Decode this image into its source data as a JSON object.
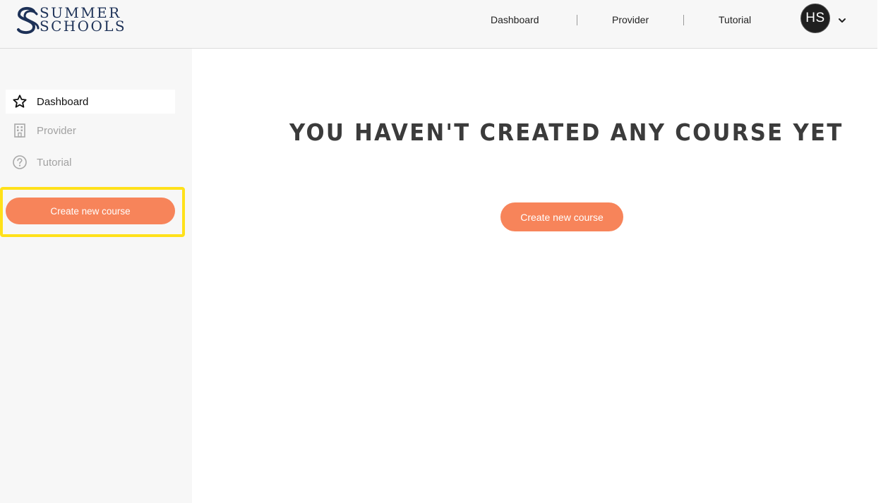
{
  "brand": {
    "line1": "SUMMER",
    "line2": "SCHOOLS",
    "color": "#1d3157"
  },
  "topnav": {
    "items": [
      {
        "label": "Dashboard"
      },
      {
        "label": "Provider"
      },
      {
        "label": "Tutorial"
      }
    ],
    "user_initials": "HS"
  },
  "sidebar": {
    "items": [
      {
        "label": "Dashboard",
        "icon": "star-icon",
        "active": true
      },
      {
        "label": "Provider",
        "icon": "building-icon",
        "active": false
      },
      {
        "label": "Tutorial",
        "icon": "help-circle-icon",
        "active": false
      }
    ],
    "create_button_label": "Create new course"
  },
  "main": {
    "empty_title": "YOU HAVEN'T CREATED ANY COURSE YET",
    "create_button_label": "Create new course"
  },
  "colors": {
    "accent": "#f7845a",
    "highlight": "#ffe11a",
    "panel_bg": "#f7f7f7"
  }
}
